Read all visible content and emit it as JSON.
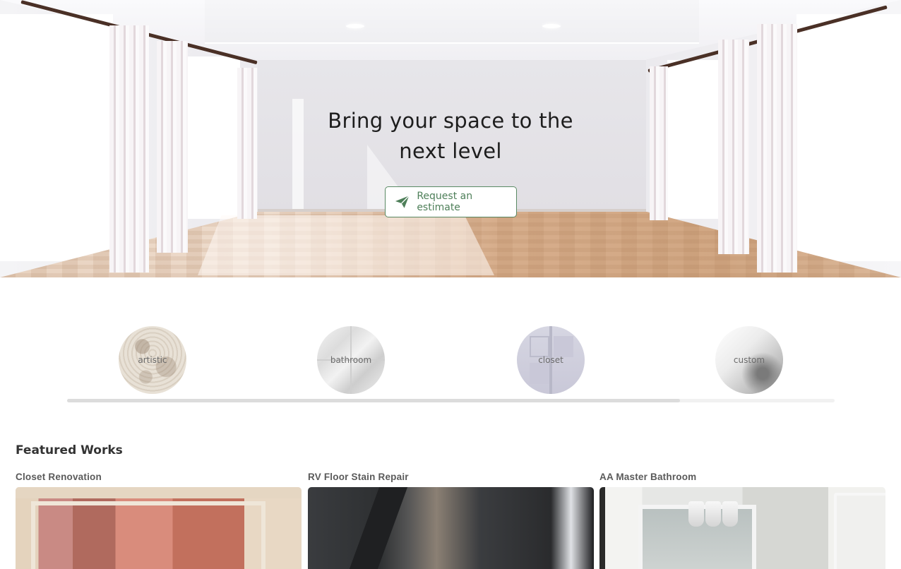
{
  "hero": {
    "title": "Bring your space to the next level",
    "cta_label": "Request an estimate",
    "accent_color": "#4e7f59"
  },
  "categories": [
    {
      "label": "artistic"
    },
    {
      "label": "bathroom"
    },
    {
      "label": "closet"
    },
    {
      "label": "custom"
    }
  ],
  "featured": {
    "title": "Featured Works",
    "works": [
      {
        "title": "Closet Renovation"
      },
      {
        "title": "RV Floor Stain Repair"
      },
      {
        "title": "AA Master Bathroom"
      }
    ]
  }
}
